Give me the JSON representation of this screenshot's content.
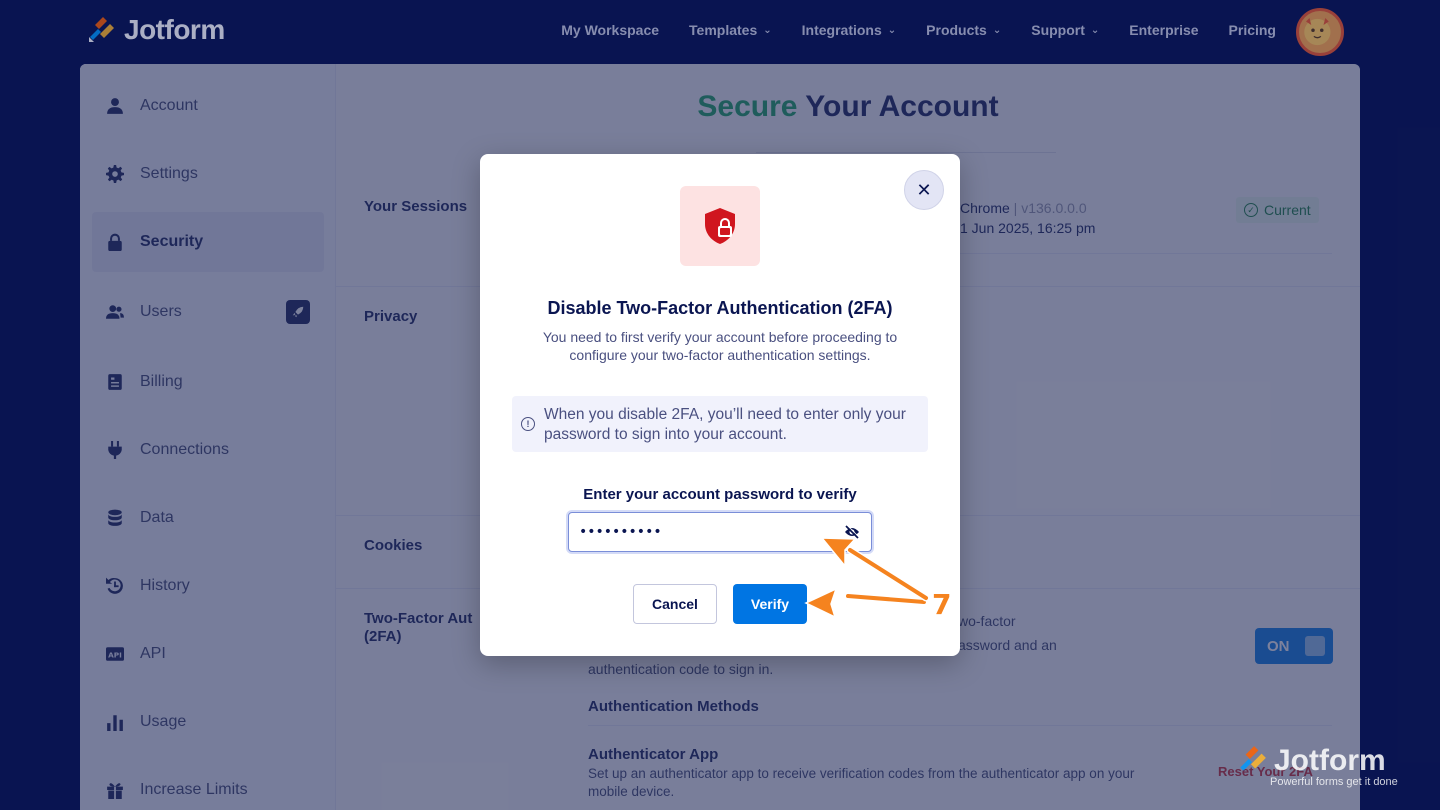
{
  "brand": {
    "name": "Jotform"
  },
  "nav": [
    {
      "label": "My Workspace",
      "dropdown": false
    },
    {
      "label": "Templates",
      "dropdown": true
    },
    {
      "label": "Integrations",
      "dropdown": true
    },
    {
      "label": "Products",
      "dropdown": true
    },
    {
      "label": "Support",
      "dropdown": true
    },
    {
      "label": "Enterprise",
      "dropdown": false
    },
    {
      "label": "Pricing",
      "dropdown": false
    }
  ],
  "sidebar": {
    "items": [
      {
        "label": "Account",
        "icon": "user-icon"
      },
      {
        "label": "Settings",
        "icon": "gear-icon"
      },
      {
        "label": "Security",
        "icon": "lock-icon",
        "active": true
      },
      {
        "label": "Users",
        "icon": "users-icon"
      },
      {
        "label": "Billing",
        "icon": "billing-icon"
      },
      {
        "label": "Connections",
        "icon": "plug-icon"
      },
      {
        "label": "Data",
        "icon": "database-icon"
      },
      {
        "label": "History",
        "icon": "history-icon"
      },
      {
        "label": "API",
        "icon": "api-icon"
      },
      {
        "label": "Usage",
        "icon": "chart-icon"
      },
      {
        "label": "Increase Limits",
        "icon": "gift-icon"
      }
    ]
  },
  "main": {
    "title_highlight": "Secure",
    "title_rest": " Your Account",
    "sections": {
      "sessions": "Your Sessions",
      "privacy": "Privacy",
      "cookies": "Cookies",
      "tfa_line1": "Two-Factor Aut",
      "tfa_line2": "(2FA)"
    },
    "session": {
      "browser": "Chrome",
      "separator": " | ",
      "version": "v136.0.0.0",
      "time": "1 Jun 2025, 16:25 pm",
      "badge": "Current"
    },
    "tfa": {
      "text_line1": "wo-factor",
      "text_line2": "assword and an",
      "text_line3": "authentication code to sign in.",
      "toggle_label": "ON",
      "methods_heading": "Authentication Methods",
      "app_heading": "Authenticator App",
      "app_desc_line1": "Set up an authenticator app to receive verification codes from the authenticator app on your",
      "app_desc_line2": "mobile device.",
      "reset_link": "Reset Your 2FA"
    }
  },
  "modal": {
    "title": "Disable Two-Factor Authentication (2FA)",
    "description": "You need to first verify your account before proceeding to configure your two-factor authentication settings.",
    "info": "When you disable 2FA, you’ll need to enter only your password to sign into your account.",
    "password_label": "Enter your account password to verify",
    "password_value": "••••••••••",
    "cancel_label": "Cancel",
    "verify_label": "Verify",
    "close_symbol": "✕"
  },
  "annotation": {
    "step": "7",
    "color": "#f5831f"
  },
  "watermark": {
    "name": "Jotform",
    "tagline": "Powerful forms get it done"
  },
  "colors": {
    "navy": "#0a1551",
    "green": "#0f9d58",
    "blue": "#0075e3",
    "danger": "#d0161f"
  }
}
